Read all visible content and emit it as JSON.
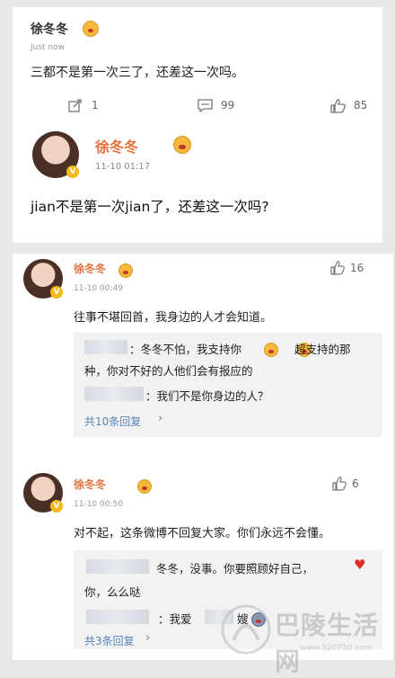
{
  "post": {
    "author": "徐冬冬",
    "time": "Just now",
    "text": "三都不是第一次三了，还差这一次吗。",
    "share_count": "1",
    "comment_count": "99",
    "like_count": "85"
  },
  "inner": {
    "author": "徐冬冬",
    "time": "11-10 01:17",
    "text": "jian不是第一次jian了，还差这一次吗?"
  },
  "comments": [
    {
      "author": "徐冬冬",
      "time": "11-10 00:49",
      "likes": "16",
      "text": "往事不堪回首，我身边的人才会知道。",
      "reply1_a": "：冬冬不怕，我支持你",
      "reply1_b": "超支持的那",
      "reply1_c": "种，你对不好的人他们会有报应的",
      "reply2": "：我们不是你身边的人？",
      "more": "共10条回复"
    },
    {
      "author": "徐冬冬",
      "time": "11-10 00:50",
      "likes": "6",
      "text": "对不起，这条微博不回复大家。你们永远不会懂。",
      "reply1_a": "冬冬，没事。你要照顾好自己，",
      "reply1_b": "你，么么哒",
      "reply2_a": "：我爱",
      "reply2_b": "嫂",
      "more": "共3条回复"
    }
  ],
  "watermark": {
    "text": "巴陵生活网",
    "url": "www.520730.com"
  }
}
